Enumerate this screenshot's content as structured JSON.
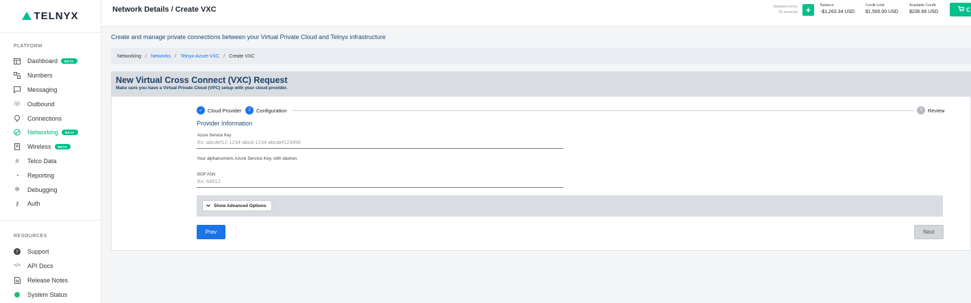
{
  "brand": {
    "name": "TELNYX",
    "accent": "#00c08b"
  },
  "sidebar": {
    "platform_title": "PLATFORM",
    "platform_items": [
      {
        "label": "Dashboard",
        "icon": "dashboard-icon",
        "beta": "BETA"
      },
      {
        "label": "Numbers",
        "icon": "numbers-icon"
      },
      {
        "label": "Messaging",
        "icon": "message-icon"
      },
      {
        "label": "Outbound",
        "icon": "phone-icon"
      },
      {
        "label": "Connections",
        "icon": "connections-icon"
      },
      {
        "label": "Networking",
        "icon": "networking-icon",
        "beta": "BETA",
        "active": true
      },
      {
        "label": "Wireless",
        "icon": "wireless-icon",
        "beta": "BETA"
      },
      {
        "label": "Telco Data",
        "icon": "hash-icon"
      },
      {
        "label": "Reporting",
        "icon": "pie-chart-icon"
      },
      {
        "label": "Debugging",
        "icon": "bug-icon"
      },
      {
        "label": "Auth",
        "icon": "key-icon"
      }
    ],
    "resources_title": "RESOURCES",
    "resource_items": [
      {
        "label": "Support",
        "icon": "help-icon"
      },
      {
        "label": "API Docs",
        "icon": "code-icon"
      },
      {
        "label": "Release Notes",
        "icon": "document-icon"
      },
      {
        "label": "System Status",
        "icon": "status-dot-icon"
      }
    ]
  },
  "header": {
    "title": "Network Details / Create VXC",
    "updated_line1": "Updated every",
    "updated_line2": "30 seconds",
    "balance_label": "Balance",
    "balance_value": "-$1,263.34 USD",
    "credit_label": "Credit Limit",
    "credit_value": "$1,500.00 USD",
    "available_label": "Available Credit",
    "available_value": "$236.66 USD",
    "cart_label": "C"
  },
  "main": {
    "intro": "Create and manage private connections between your Virtual Private Cloud and Telnyx infrastructure",
    "breadcrumb": [
      "Networking",
      "Networks",
      "Telnyx-Azure-VXC",
      "Create VXC"
    ],
    "card_title": "New Virtual Cross Connect (VXC) Request",
    "card_subtitle": "Make sure you have a Virtual Private Cloud (VPC) setup with your cloud provider.",
    "steps": [
      {
        "num": "✓",
        "label": "Cloud Provider"
      },
      {
        "num": "2",
        "label": "Configuration"
      },
      {
        "num": "3",
        "label": "Review"
      }
    ],
    "provider_title": "Provider Information",
    "azure_key_label": "Azure Service Key",
    "azure_key_placeholder": "Ex: abcdef12-1234-abcd-1234-abcdef123456",
    "azure_key_value": "",
    "azure_key_helper": "Your alphanumeric Azure Service Key, with dashes",
    "bgp_label": "BGP ASN",
    "bgp_placeholder": "Ex: 64512",
    "bgp_value": "",
    "advanced_label": "Show Advanced Options",
    "prev_label": "Prev",
    "next_label": "Next"
  }
}
